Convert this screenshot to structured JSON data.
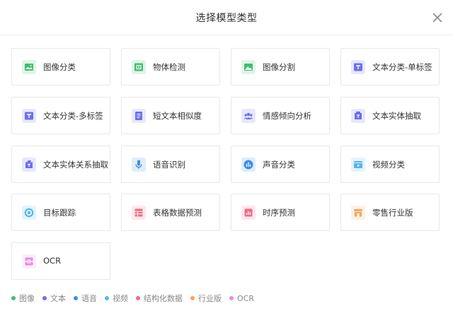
{
  "dialog": {
    "title": "选择模型类型"
  },
  "colors": {
    "image": "#3dbf6c",
    "text": "#6b6ff0",
    "voice": "#3a8ee6",
    "video": "#54b6f0",
    "structured": "#f06b84",
    "industry": "#f5a45a",
    "ocr": "#e48ce6"
  },
  "cards": [
    {
      "label": "图像分类",
      "icon": "image-icon",
      "category": "image"
    },
    {
      "label": "物体检测",
      "icon": "object-detect-icon",
      "category": "image"
    },
    {
      "label": "图像分割",
      "icon": "image-segment-icon",
      "category": "image"
    },
    {
      "label": "文本分类-单标签",
      "icon": "text-t-icon",
      "category": "text"
    },
    {
      "label": "文本分类-多标签",
      "icon": "text-t-multi-icon",
      "category": "text"
    },
    {
      "label": "短文本相似度",
      "icon": "text-lines-icon",
      "category": "text"
    },
    {
      "label": "情感倾向分析",
      "icon": "people-icon",
      "category": "text"
    },
    {
      "label": "文本实体抽取",
      "icon": "entity-icon",
      "category": "text"
    },
    {
      "label": "文本实体关系抽取",
      "icon": "relation-icon",
      "category": "text"
    },
    {
      "label": "语音识别",
      "icon": "microphone-icon",
      "category": "voice"
    },
    {
      "label": "声音分类",
      "icon": "sound-bars-icon",
      "category": "voice"
    },
    {
      "label": "视频分类",
      "icon": "video-play-icon",
      "category": "video"
    },
    {
      "label": "目标跟踪",
      "icon": "target-icon",
      "category": "video"
    },
    {
      "label": "表格数据预测",
      "icon": "table-icon",
      "category": "structured"
    },
    {
      "label": "时序预测",
      "icon": "bar-chart-icon",
      "category": "structured"
    },
    {
      "label": "零售行业版",
      "icon": "store-icon",
      "category": "industry"
    },
    {
      "label": "OCR",
      "icon": "ocr-scan-icon",
      "category": "ocr"
    }
  ],
  "legend": [
    {
      "label": "图像",
      "category": "image"
    },
    {
      "label": "文本",
      "category": "text"
    },
    {
      "label": "语音",
      "category": "voice"
    },
    {
      "label": "视频",
      "category": "video"
    },
    {
      "label": "结构化数据",
      "category": "structured"
    },
    {
      "label": "行业版",
      "category": "industry"
    },
    {
      "label": "OCR",
      "category": "ocr"
    }
  ]
}
